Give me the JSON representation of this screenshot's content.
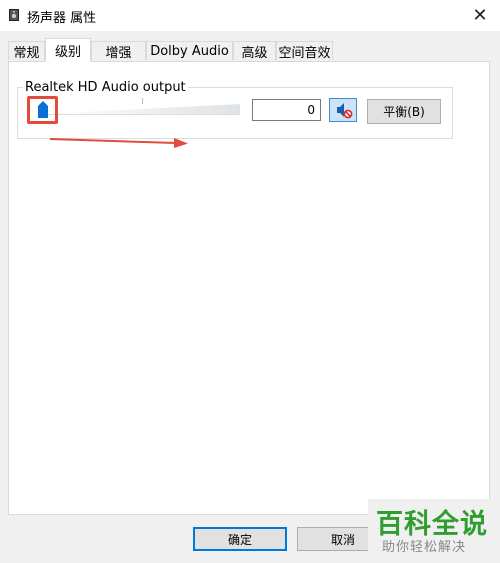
{
  "window": {
    "title": "扬声器 属性",
    "icon": "speaker-icon",
    "close_glyph": "✕"
  },
  "tabs": [
    {
      "label": "常规",
      "active": false
    },
    {
      "label": "级别",
      "active": true
    },
    {
      "label": "增强",
      "active": false
    },
    {
      "label": "Dolby Audio",
      "active": false
    },
    {
      "label": "高级",
      "active": false
    },
    {
      "label": "空间音效",
      "active": false
    }
  ],
  "levels": {
    "device_label": "Realtek HD Audio output",
    "volume_value": "0",
    "volume_level": 0,
    "mute_icon": "speaker-muted-icon",
    "balance_label": "平衡(B)"
  },
  "annotations": {
    "highlight_color": "#e24b3d",
    "arrow_color": "#e24b3d"
  },
  "footer": {
    "ok_label": "确定",
    "cancel_label": "取消"
  },
  "watermark": {
    "title": "百科全说",
    "subtitle": "助你轻松解决"
  }
}
